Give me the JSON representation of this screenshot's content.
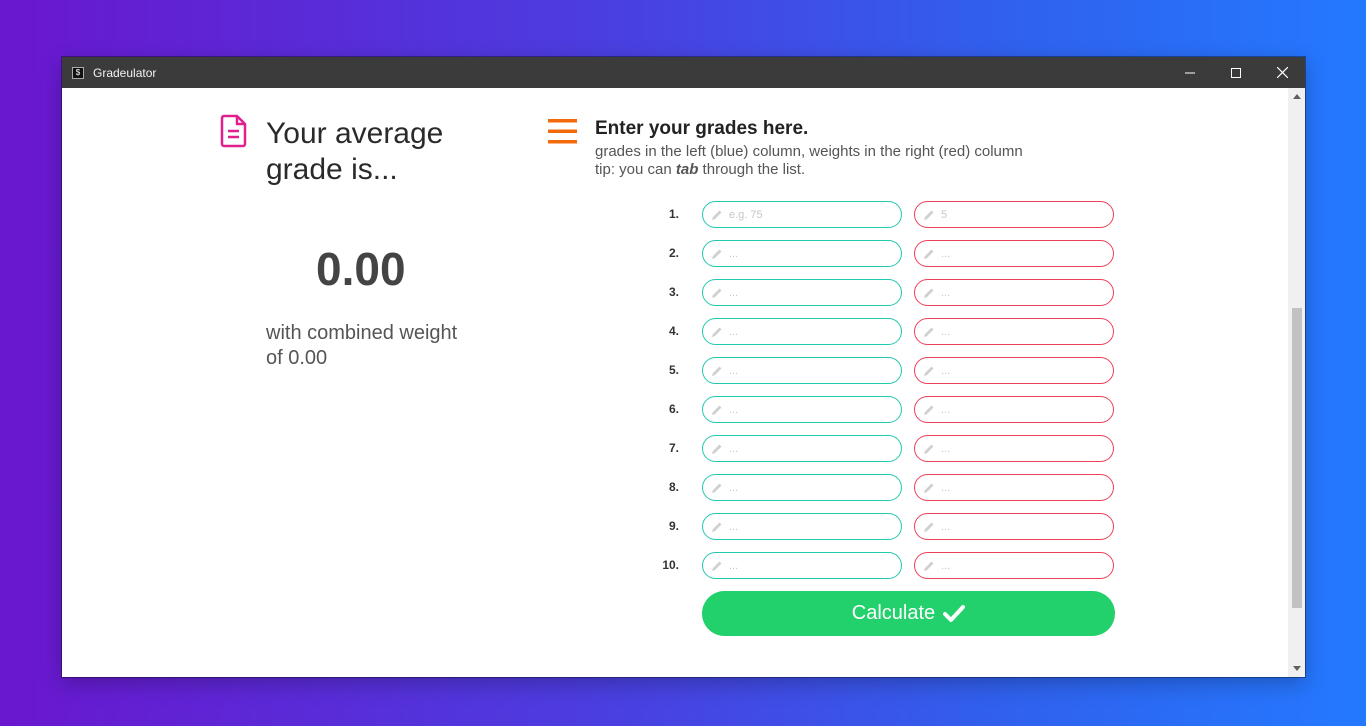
{
  "window": {
    "title": "Gradeulator",
    "icon_char": "$",
    "controls": [
      "minimize",
      "maximize",
      "close"
    ]
  },
  "left": {
    "title": "Your average grade is...",
    "average": "0.00",
    "weight_text": "with combined weight of 0.00",
    "icon": "document-icon"
  },
  "right": {
    "heading": "Enter your grades here.",
    "subtitle": "grades in the left (blue) column, weights in the right (red) column",
    "tip_prefix": "tip: you can ",
    "tip_em": "tab",
    "tip_suffix": " through the list.",
    "icon": "menu-icon"
  },
  "rows": [
    {
      "num": "1.",
      "grade_placeholder": "e.g. 75",
      "weight_placeholder": "5"
    },
    {
      "num": "2.",
      "grade_placeholder": "...",
      "weight_placeholder": "..."
    },
    {
      "num": "3.",
      "grade_placeholder": "...",
      "weight_placeholder": "..."
    },
    {
      "num": "4.",
      "grade_placeholder": "...",
      "weight_placeholder": "..."
    },
    {
      "num": "5.",
      "grade_placeholder": "...",
      "weight_placeholder": "..."
    },
    {
      "num": "6.",
      "grade_placeholder": "...",
      "weight_placeholder": "..."
    },
    {
      "num": "7.",
      "grade_placeholder": "...",
      "weight_placeholder": "..."
    },
    {
      "num": "8.",
      "grade_placeholder": "...",
      "weight_placeholder": "..."
    },
    {
      "num": "9.",
      "grade_placeholder": "...",
      "weight_placeholder": "..."
    },
    {
      "num": "10.",
      "grade_placeholder": "...",
      "weight_placeholder": "..."
    }
  ],
  "calculate_label": "Calculate",
  "colors": {
    "grade_border": "#21c9b0",
    "weight_border": "#ee3f5a",
    "button": "#22d16b",
    "doc_icon": "#e0208f",
    "menu_icon": "#f26a0a"
  }
}
